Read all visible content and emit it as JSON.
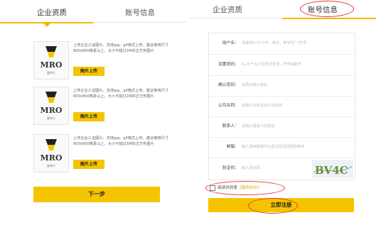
{
  "left": {
    "tabs": {
      "active": "企业资质",
      "inactive": "账号信息"
    },
    "uploads": [
      {
        "description": "上传企业三证图片，支持jpg、gif格式上传，建议使用尺寸800x800像素以上、大小不超过1M的正方形图片",
        "button": "图片上传"
      },
      {
        "description": "上传企业三证图片，支持jpg、gif格式上传，建议使用尺寸800x800像素以上、大小不超过1M的正方形图片",
        "button": "图片上传"
      },
      {
        "description": "上传企业三证图片，支持jpg、gif格式上传，建议使用尺寸800x800像素以上、大小不超过1M的正方形图片",
        "button": "图片上传"
      }
    ],
    "logo": {
      "text": "MRO",
      "caption": "震坤行"
    },
    "next_button": "下一步"
  },
  "right": {
    "tabs": {
      "inactive": "企业资质",
      "active": "账号信息"
    },
    "fields": [
      {
        "label": "用户名：",
        "placeholder": "请使用3-15个中、英文、数字及\"-\"符号"
      },
      {
        "label": "设置密码：",
        "placeholder": "6-20个大小写英文字母、符号或数字"
      },
      {
        "label": "确认密码：",
        "placeholder": "请再次输入密码"
      },
      {
        "label": "公司名称：",
        "placeholder": "请输入您所在的公司名称"
      },
      {
        "label": "联系人：",
        "placeholder": "请输入联系人的姓名"
      },
      {
        "label": "邮箱：",
        "placeholder": "输入常用邮箱作为验证及找回密码使用"
      },
      {
        "label": "验证码：",
        "placeholder": "输入验证码"
      }
    ],
    "captcha_text": "BV4C",
    "agreement": {
      "prefix": "阅读并同意",
      "link": "《服务协议》"
    },
    "register_button": "立即注册"
  },
  "colors": {
    "accent": "#f5c400",
    "highlight": "#e53935"
  }
}
